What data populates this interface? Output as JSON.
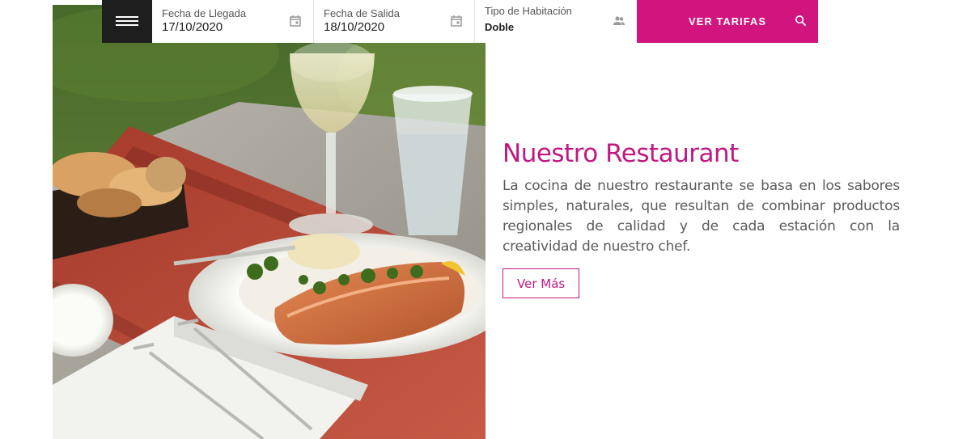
{
  "booking": {
    "menu_icon": "hamburger-menu-icon",
    "arrival": {
      "label": "Fecha de Llegada",
      "value": "17/10/2020",
      "icon": "calendar-icon"
    },
    "departure": {
      "label": "Fecha de Salida",
      "value": "18/10/2020",
      "icon": "calendar-icon"
    },
    "room": {
      "label": "Tipo de Habitación",
      "value": "Doble",
      "icon": "people-icon"
    },
    "rates_button": {
      "label": "VER TARIFAS",
      "icon": "search-icon"
    }
  },
  "restaurant": {
    "title": "Nuestro Restaurant",
    "description": "La cocina de nuestro restaurante se basa en los sabores simples, naturales, que resultan de combinar productos regionales de calidad y de cada estación con la creatividad de nuestro chef.",
    "more_button": "Ver Más"
  },
  "colors": {
    "accent": "#d1147e",
    "title": "#c01880",
    "menu_bg": "#1e1e1e",
    "body_text": "#5b5b5b"
  }
}
